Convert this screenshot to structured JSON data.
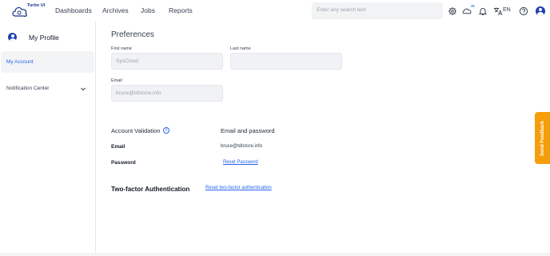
{
  "app": {
    "logo_text": "Turbo UI"
  },
  "nav": {
    "items": [
      "Dashboards",
      "Archives",
      "Jobs",
      "Reports"
    ]
  },
  "search": {
    "placeholder": "Enter any search text"
  },
  "toolbar": {
    "icons": [
      "gear-icon",
      "cloud-ai-icon",
      "bell-icon",
      "translate-icon",
      "help-icon",
      "user-avatar-icon"
    ],
    "ai_badge": "AI",
    "language": "EN"
  },
  "sidebar": {
    "title": "My Profile",
    "items": [
      {
        "label": "My Account",
        "active": true
      },
      {
        "label": "Notification Center",
        "active": false,
        "expandable": true
      }
    ]
  },
  "preferences": {
    "title": "Preferences",
    "first_name_label": "First name",
    "first_name_value": "SysCloud",
    "last_name_label": "Last name",
    "last_name_value": "",
    "email_label": "Email",
    "email_value": "bruce@tdlstore.info"
  },
  "validation": {
    "title": "Account Validation",
    "method": "Email and password",
    "email_label": "Email",
    "email_value": "bruce@tdlstore.info",
    "password_label": "Password",
    "reset_password": "Reset Password"
  },
  "twofa": {
    "title": "Two-factor Authentication",
    "reset_link": "Reset two-factor authentication"
  },
  "feedback": {
    "label": "Send Feedback"
  },
  "colors": {
    "accent": "#2563eb",
    "brand": "#1e40af",
    "feedback": "#f59e0b"
  }
}
